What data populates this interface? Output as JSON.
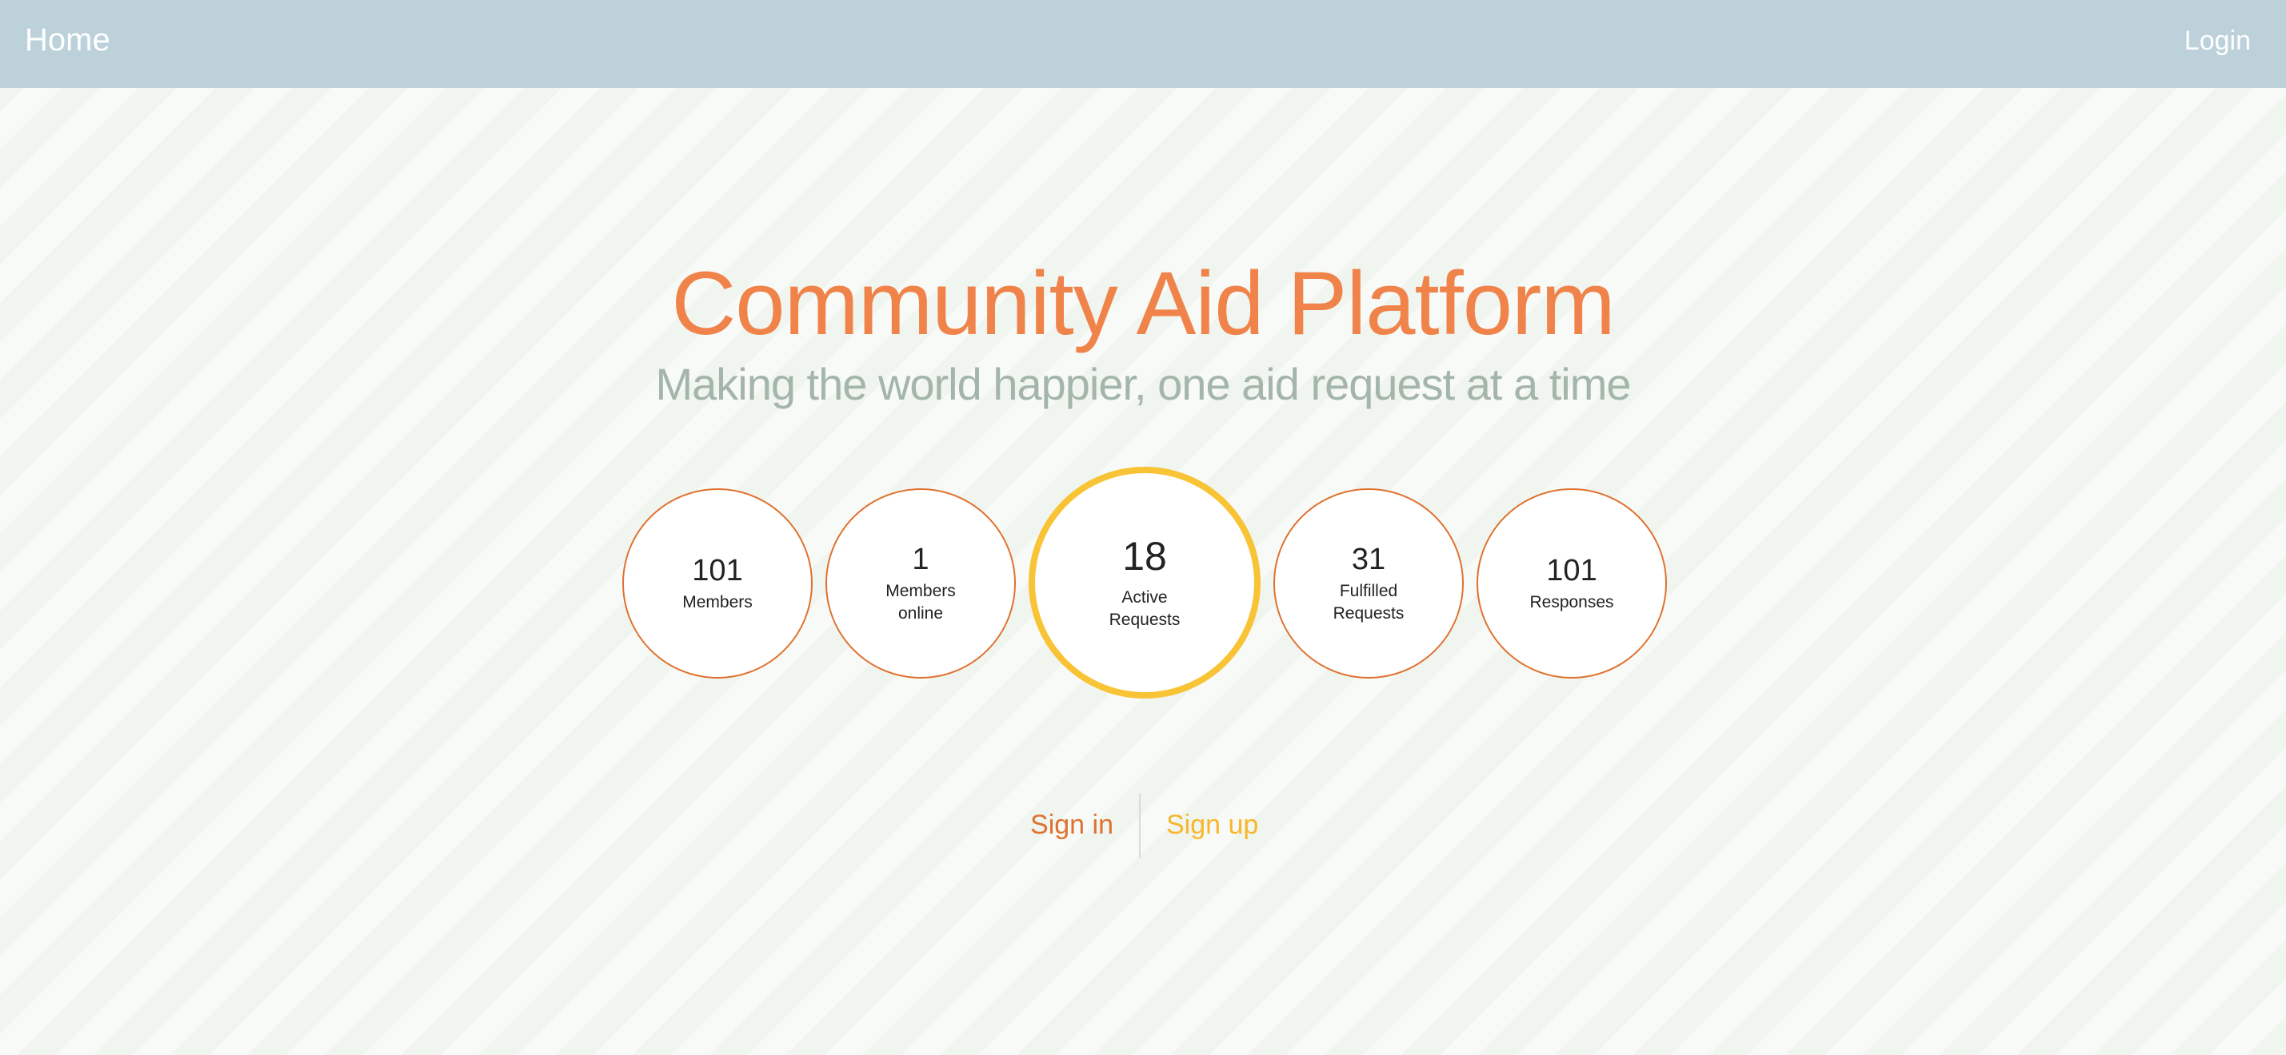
{
  "nav": {
    "home_label": "Home",
    "login_label": "Login"
  },
  "hero": {
    "title": "Community Aid Platform",
    "subtitle": "Making the world happier, one aid request at a time"
  },
  "stats": [
    {
      "value": "101",
      "label": "Members"
    },
    {
      "value": "1",
      "label": "Members online"
    },
    {
      "value": "18",
      "label": "Active Requests"
    },
    {
      "value": "31",
      "label": "Fulfilled Requests"
    },
    {
      "value": "101",
      "label": "Responses"
    }
  ],
  "auth": {
    "sign_in_label": "Sign in",
    "sign_up_label": "Sign up"
  },
  "colors": {
    "navbar": "#bcd1da",
    "title": "#f0834a",
    "stat_border": "#e0712e",
    "highlight_border": "#f8c334",
    "sign_up": "#f8b62b"
  }
}
